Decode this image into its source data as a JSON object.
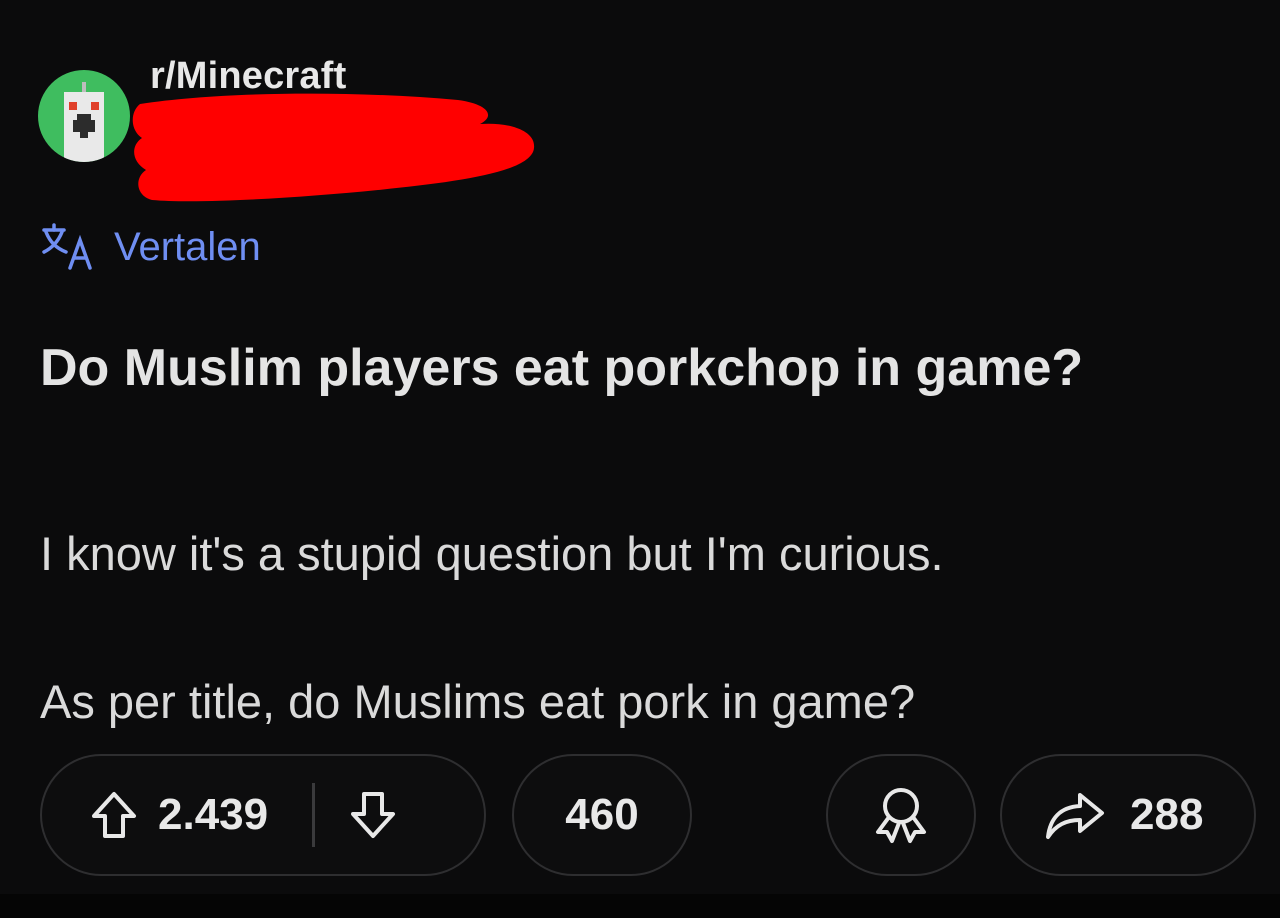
{
  "post": {
    "subreddit": "r/Minecraft",
    "translate_label": "Vertalen",
    "title": "Do Muslim players eat porkchop in game?",
    "body": [
      "I know it's a stupid question but I'm curious.",
      "As per title, do Muslims eat pork in game?"
    ]
  },
  "actions": {
    "upvote_count": "2.439",
    "comment_count": "460",
    "share_count": "288"
  },
  "icons": {
    "avatar": "creeper-avatar-icon",
    "translate": "translate-icon",
    "upvote": "arrow-up-icon",
    "downvote": "arrow-down-icon",
    "award": "award-icon",
    "share": "share-arrow-icon"
  },
  "colors": {
    "background": "#0b0b0c",
    "accent_link": "#6f8ef2",
    "avatar_bg": "#3fbd5f",
    "redaction": "#ff0000"
  }
}
